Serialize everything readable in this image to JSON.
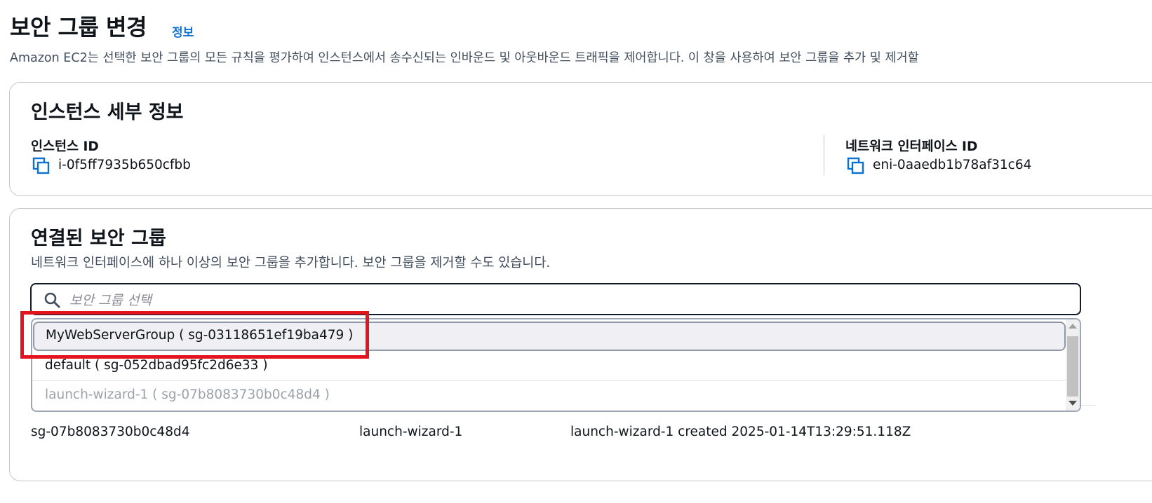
{
  "page": {
    "title": "보안 그룹 변경",
    "info_link": "정보",
    "description": "Amazon EC2는 선택한 보안 그룹의 모든 규칙을 평가하여 인스턴스에서 송수신되는 인바운드 및 아웃바운드 트래픽을 제어합니다. 이 창을 사용하여 보안 그룹을 추가 및 제거할"
  },
  "instance_details": {
    "title": "인스턴스 세부 정보",
    "instance_id_label": "인스턴스 ID",
    "instance_id": "i-0f5ff7935b650cfbb",
    "eni_label": "네트워크 인터페이스 ID",
    "eni_id": "eni-0aaedb1b78af31c64"
  },
  "security_groups": {
    "title": "연결된 보안 그룹",
    "description": "네트워크 인터페이스에 하나 이상의 보안 그룹을 추가합니다. 보안 그룹을 제거할 수도 있습니다.",
    "search_placeholder": "보안 그룹 선택",
    "options": [
      {
        "label": "MyWebServerGroup ( sg-03118651ef19ba479 )",
        "state": "highlighted"
      },
      {
        "label": "default ( sg-052dbad95fc2d6e33 )",
        "state": "normal"
      },
      {
        "label": "launch-wizard-1 ( sg-07b8083730b0c48d4 )",
        "state": "disabled"
      }
    ],
    "table_row": {
      "group_id": "sg-07b8083730b0c48d4",
      "name": "launch-wizard-1",
      "description": "launch-wizard-1 created 2025-01-14T13:29:51.118Z"
    }
  },
  "colors": {
    "link": "#0972d3",
    "annotation_highlight": "#e3141e",
    "focus_border": "#0f1b2a"
  },
  "icons": [
    "copy-icon",
    "search-icon"
  ]
}
